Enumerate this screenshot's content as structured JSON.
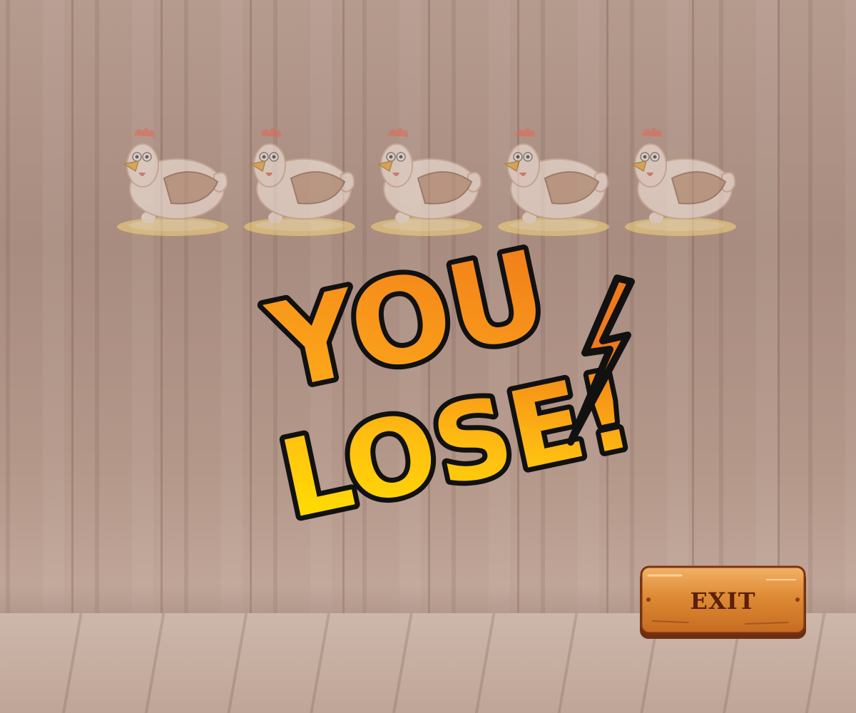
{
  "game": {
    "status_text_line1": "YOU",
    "status_text_line2": "LOSE!",
    "hens_shown": 5,
    "hen_icon": "hen-icon",
    "exit_label": "EXIT"
  },
  "colors": {
    "title_orange": "#f28b1c",
    "title_yellow": "#ffd400",
    "title_outline": "#111111",
    "button_wood": "#d9822b",
    "button_text": "#5b1f0c"
  }
}
